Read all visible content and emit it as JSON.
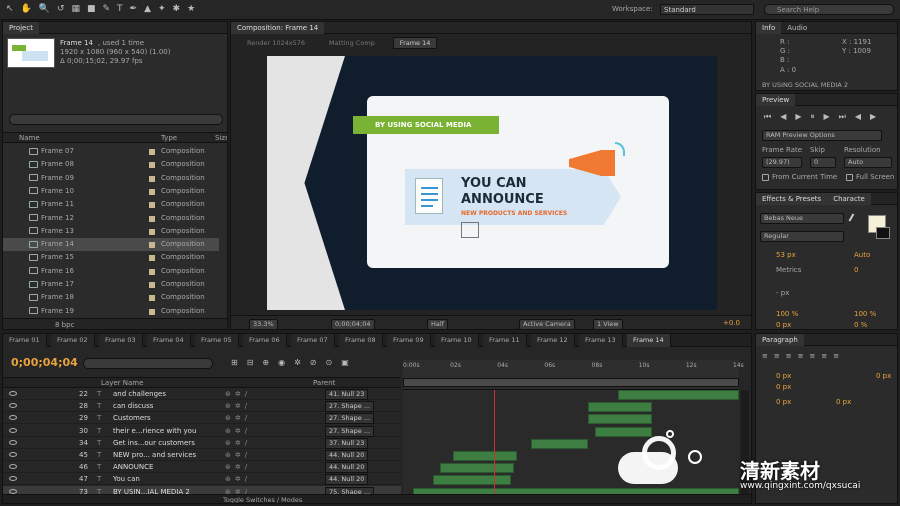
{
  "toolbar": {
    "workspace_label": "Workspace:",
    "workspace_value": "Standard",
    "search_placeholder": "Search Help"
  },
  "project": {
    "tab": "Project",
    "item_name": "Frame 14",
    "item_used": ", used 1 time",
    "item_size": "1920 x 1080  (960 x 540) (1.00)",
    "item_duration": "Δ 0;00;15;02, 29.97 fps",
    "col_name": "Name",
    "col_type": "Type",
    "col_size": "Size",
    "rows": [
      {
        "name": "Frame 07",
        "type": "Composition"
      },
      {
        "name": "Frame 08",
        "type": "Composition"
      },
      {
        "name": "Frame 09",
        "type": "Composition"
      },
      {
        "name": "Frame 10",
        "type": "Composition"
      },
      {
        "name": "Frame 11",
        "type": "Composition"
      },
      {
        "name": "Frame 12",
        "type": "Composition"
      },
      {
        "name": "Frame 13",
        "type": "Composition"
      },
      {
        "name": "Frame 14",
        "type": "Composition"
      },
      {
        "name": "Frame 15",
        "type": "Composition"
      },
      {
        "name": "Frame 16",
        "type": "Composition"
      },
      {
        "name": "Frame 17",
        "type": "Composition"
      },
      {
        "name": "Frame 18",
        "type": "Composition"
      },
      {
        "name": "Frame 19",
        "type": "Composition"
      }
    ],
    "bpc": "8 bpc"
  },
  "composition": {
    "tab": "Composition: Frame 14",
    "sub_tabs": [
      "Render 1024x576",
      "Matting Comp",
      "Frame 14"
    ],
    "zoom": "33.3%",
    "timecode": "0;00;04;04",
    "quality": "Half",
    "camera": "Active Camera",
    "views": "1 View",
    "exposure": "+0.0",
    "art": {
      "ribbon_text": "BY USING SOCIAL MEDIA",
      "headline1": "YOU CAN",
      "headline2": "ANNOUNCE",
      "subline": "NEW PRODUCTS AND SERVICES"
    }
  },
  "info": {
    "tabs": [
      "Info",
      "Audio"
    ],
    "r": "R :",
    "g": "G :",
    "b": "B :",
    "a": "A : 0",
    "x": "X : 1191",
    "y": "Y : 1009",
    "layer_label": "BY USING SOCIAL MEDIA 2"
  },
  "preview": {
    "tab": "Preview",
    "ram_options": "RAM Preview Options",
    "frame_rate_label": "Frame Rate",
    "skip_label": "Skip",
    "resolution_label": "Resolution",
    "frame_rate": "(29.97)",
    "skip": "0",
    "resolution": "Auto",
    "from_current": "From Current Time",
    "full_screen": "Full Screen"
  },
  "character": {
    "tabs": [
      "Effects & Presets",
      "Characte"
    ],
    "font": "Bebas Neue",
    "style": "Regular",
    "size": "53 px",
    "leading": "Auto",
    "kerning": "Metrics",
    "tracking": "0",
    "stroke": "- px",
    "vscale": "100 %",
    "hscale": "100 %",
    "baseline": "0 px",
    "tsume": "0 %"
  },
  "paragraph": {
    "tab": "Paragraph",
    "indent1": "0 px",
    "indent2": "0 px",
    "indent3": "0 px",
    "space1": "0 px",
    "space2": "0 px"
  },
  "timeline": {
    "tabs": [
      "Frame 01",
      "Frame 02",
      "Frame 03",
      "Frame 04",
      "Frame 05",
      "Frame 06",
      "Frame 07",
      "Frame 08",
      "Frame 09",
      "Frame 10",
      "Frame 11",
      "Frame 12",
      "Frame 13",
      "Frame 14"
    ],
    "timecode": "0;00;04;04",
    "col_layer": "Layer Name",
    "col_parent": "Parent",
    "ruler": [
      "0:00s",
      "02s",
      "04s",
      "06s",
      "08s",
      "10s",
      "12s",
      "14s"
    ],
    "layers": [
      {
        "num": "22",
        "name": "and challenges",
        "parent": "41. Null 23",
        "start": 0.64,
        "end": 1.0
      },
      {
        "num": "28",
        "name": "can discuss",
        "parent": "27. Shape ...",
        "start": 0.55,
        "end": 0.74
      },
      {
        "num": "29",
        "name": "Customers",
        "parent": "27. Shape ...",
        "start": 0.55,
        "end": 0.74
      },
      {
        "num": "30",
        "name": "their e...rience with you",
        "parent": "27. Shape ...",
        "start": 0.57,
        "end": 0.74
      },
      {
        "num": "34",
        "name": "Get ins...our customers",
        "parent": "37. Null 23",
        "start": 0.38,
        "end": 0.55
      },
      {
        "num": "45",
        "name": "NEW pro... and services",
        "parent": "44. Null 20",
        "start": 0.15,
        "end": 0.34
      },
      {
        "num": "46",
        "name": "ANNOUNCE",
        "parent": "44. Null 20",
        "start": 0.11,
        "end": 0.33
      },
      {
        "num": "47",
        "name": "You can",
        "parent": "44. Null 20",
        "start": 0.09,
        "end": 0.32
      },
      {
        "num": "73",
        "name": "BY USIN...IAL MEDIA 2",
        "parent": "75. Shape ...",
        "start": 0.03,
        "end": 1.0
      }
    ],
    "toggle_label": "Toggle Switches / Modes"
  },
  "watermark": {
    "cn": "清新素材",
    "url": "www.qingxint.com/qxsucai"
  },
  "colors": {
    "accent": "#e8a33c",
    "track": "#3f7e43",
    "playhead": "#d03030"
  }
}
